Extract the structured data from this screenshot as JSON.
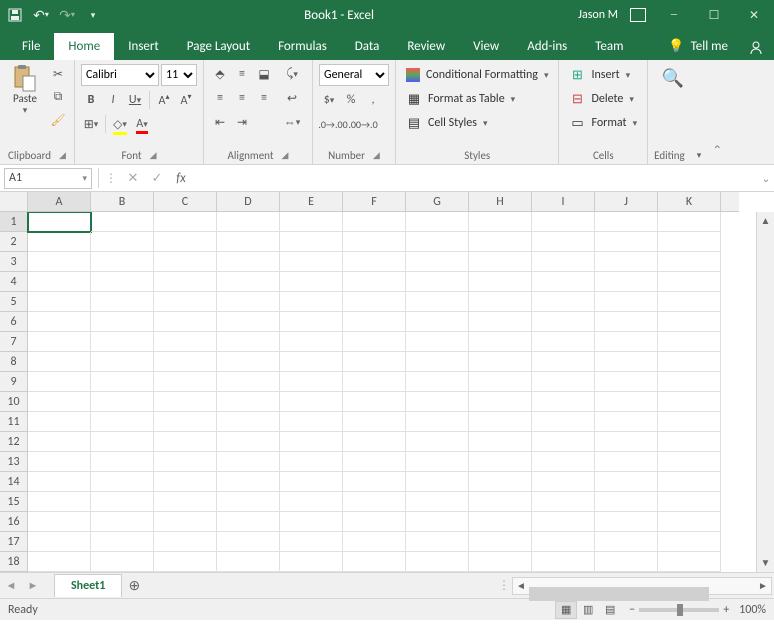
{
  "title": "Book1  -  Excel",
  "user": "Jason M",
  "qat": {
    "save": "save",
    "undo": "undo",
    "redo": "redo"
  },
  "tabs": [
    "File",
    "Home",
    "Insert",
    "Page Layout",
    "Formulas",
    "Data",
    "Review",
    "View",
    "Add-ins",
    "Team"
  ],
  "active_tab": "Home",
  "tellme": "Tell me",
  "ribbon": {
    "clipboard": {
      "paste": "Paste",
      "label": "Clipboard"
    },
    "font": {
      "label": "Font",
      "family": "Calibri",
      "size": "11",
      "bold": "B",
      "italic": "I",
      "underline": "U"
    },
    "alignment": {
      "label": "Alignment"
    },
    "number": {
      "label": "Number",
      "format": "General",
      "currency": "$",
      "percent": "%",
      "comma": ","
    },
    "styles": {
      "label": "Styles",
      "cond": "Conditional Formatting",
      "table": "Format as Table",
      "cell": "Cell Styles"
    },
    "cells": {
      "label": "Cells",
      "insert": "Insert",
      "delete": "Delete",
      "format": "Format"
    },
    "editing": {
      "label": "Editing"
    }
  },
  "namebox": "A1",
  "formula": "",
  "columns": [
    "A",
    "B",
    "C",
    "D",
    "E",
    "F",
    "G",
    "H",
    "I",
    "J",
    "K"
  ],
  "rows": [
    1,
    2,
    3,
    4,
    5,
    6,
    7,
    8,
    9,
    10,
    11,
    12,
    13,
    14,
    15,
    16,
    17,
    18
  ],
  "active_cell": {
    "row": 1,
    "col": "A"
  },
  "sheet": "Sheet1",
  "status": "Ready",
  "zoom": "100%"
}
